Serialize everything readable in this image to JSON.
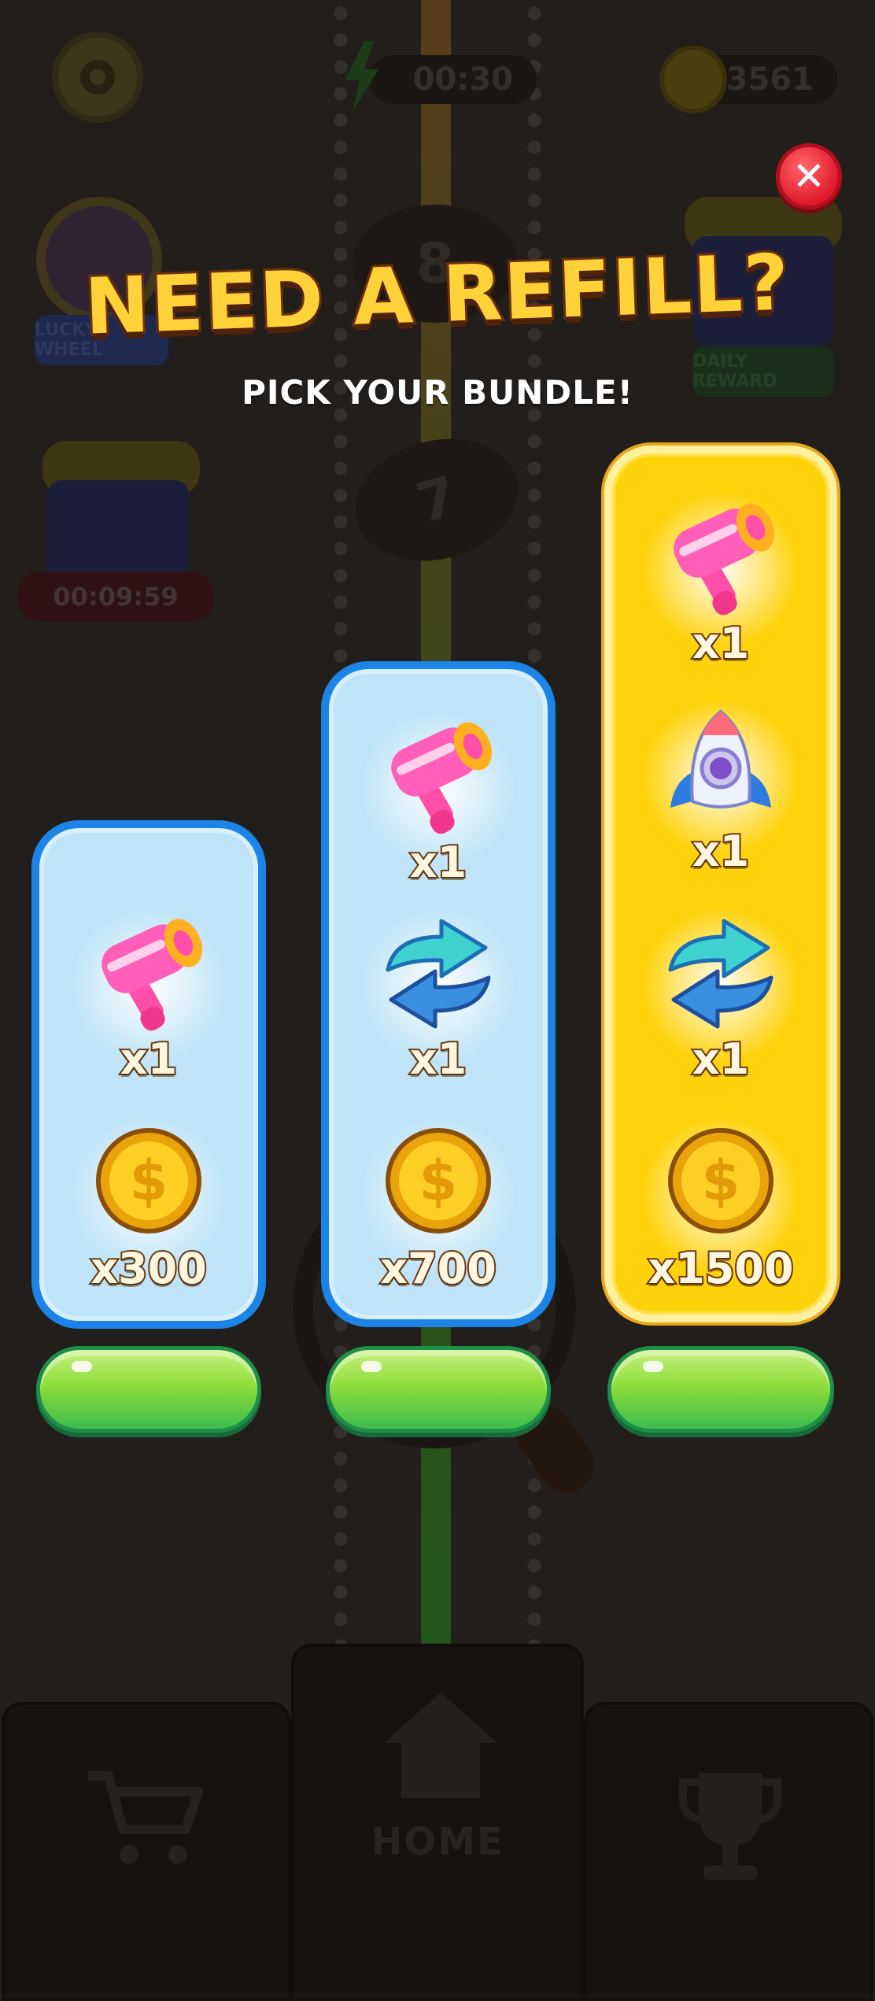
{
  "hud": {
    "timer": "00:30",
    "coins": "23561"
  },
  "background": {
    "lucky_wheel_label": "LUCKY WHEEL",
    "daily_reward_label": "DAILY REWARD",
    "gift_timer": "00:09:59",
    "disc_numbers": [
      "8",
      "7"
    ]
  },
  "nav": {
    "home_label": "HOME",
    "shop_icon": "cart-icon",
    "home_icon": "home-icon",
    "trophy_icon": "trophy-icon"
  },
  "popup": {
    "title": "NEED A REFILL?",
    "subtitle": "PICK YOUR BUNDLE!",
    "close_icon": "✕"
  },
  "bundles": [
    {
      "style": "blue",
      "rewards": [
        {
          "icon": "hammer-icon",
          "qty": "x1"
        },
        {
          "icon": "coin-icon",
          "qty": "x300"
        }
      ],
      "buy_label": ""
    },
    {
      "style": "blue",
      "rewards": [
        {
          "icon": "hammer-icon",
          "qty": "x1"
        },
        {
          "icon": "shuffle-icon",
          "qty": "x1"
        },
        {
          "icon": "coin-icon",
          "qty": "x700"
        }
      ],
      "buy_label": ""
    },
    {
      "style": "gold",
      "rewards": [
        {
          "icon": "hammer-icon",
          "qty": "x1"
        },
        {
          "icon": "rocket-icon",
          "qty": "x1"
        },
        {
          "icon": "shuffle-icon",
          "qty": "x1"
        },
        {
          "icon": "coin-icon",
          "qty": "x1500"
        }
      ],
      "buy_label": ""
    }
  ],
  "colors": {
    "card_blue_fill": "#bfe4f7",
    "card_blue_border": "#1b84e6",
    "card_gold_fill": "#ffd20c",
    "buy_button": "#8edd3a",
    "title": "#ffd23a",
    "close_button": "#e0192b"
  }
}
